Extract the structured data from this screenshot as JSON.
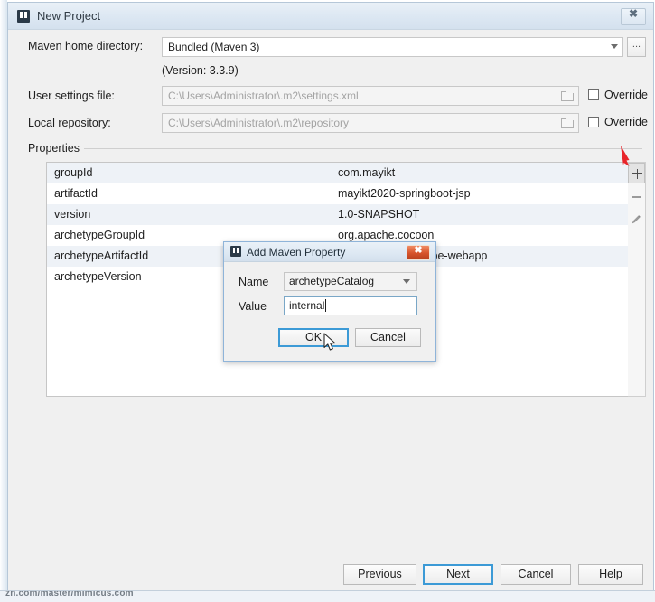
{
  "window": {
    "title": "New Project",
    "app_icon": "intellij-idea-icon",
    "close_label": "✖"
  },
  "form": {
    "maven_home": {
      "label": "Maven home directory:",
      "value": "Bundled (Maven 3)",
      "browse_label": "...",
      "version_note": "(Version: 3.3.9)"
    },
    "user_settings": {
      "label": "User settings file:",
      "value": "C:\\Users\\Administrator\\.m2\\settings.xml",
      "override_label": "Override",
      "override_checked": false
    },
    "local_repository": {
      "label": "Local repository:",
      "value": "C:\\Users\\Administrator\\.m2\\repository",
      "override_label": "Override",
      "override_checked": false
    }
  },
  "properties": {
    "group_label": "Properties",
    "rows": [
      {
        "key": "groupId",
        "value": "com.mayikt"
      },
      {
        "key": "artifactId",
        "value": "mayikt2020-springboot-jsp"
      },
      {
        "key": "version",
        "value": "1.0-SNAPSHOT"
      },
      {
        "key": "archetypeGroupId",
        "value": "org.apache.cocoon"
      },
      {
        "key": "archetypeArtifactId",
        "value": "cocoon-22-archetype-webapp"
      },
      {
        "key": "archetypeVersion",
        "value": ""
      }
    ],
    "toolbar": {
      "add_label": "+",
      "remove_label": "−",
      "edit_label": "edit"
    }
  },
  "dialog": {
    "title": "Add Maven Property",
    "icon": "intellij-idea-icon",
    "close_label": "✖",
    "name_label": "Name",
    "name_value": "archetypeCatalog",
    "value_label": "Value",
    "value_value": "internal",
    "ok_label": "OK",
    "cancel_label": "Cancel"
  },
  "wizard": {
    "previous_label": "Previous",
    "next_label": "Next",
    "cancel_label": "Cancel",
    "help_label": "Help"
  },
  "overlay": {
    "bottom_fragment": "zh.com/master/mimicus.com"
  },
  "colors": {
    "accent": "#3c9ad6",
    "annotation_red": "#e8242a",
    "titlebar": "#dde8f3",
    "row_alt": "#eef2f7",
    "close_red": "#d6532a"
  }
}
